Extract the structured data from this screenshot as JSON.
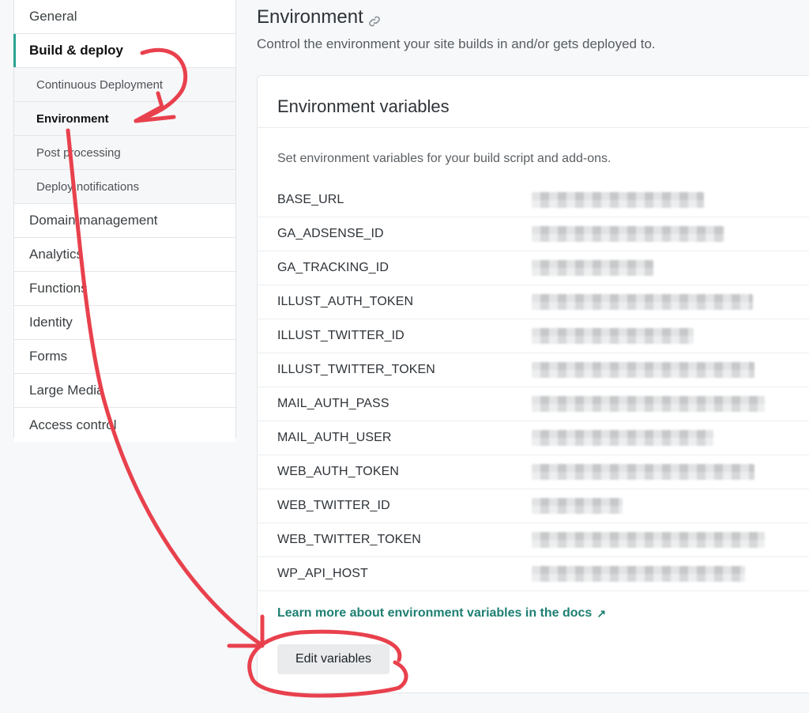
{
  "sidebar": {
    "items": [
      {
        "label": "General"
      },
      {
        "label": "Build & deploy"
      },
      {
        "label": "Domain management"
      },
      {
        "label": "Analytics"
      },
      {
        "label": "Functions"
      },
      {
        "label": "Identity"
      },
      {
        "label": "Forms"
      },
      {
        "label": "Large Media"
      },
      {
        "label": "Access control"
      }
    ],
    "subitems": [
      {
        "label": "Continuous Deployment"
      },
      {
        "label": "Environment"
      },
      {
        "label": "Post processing"
      },
      {
        "label": "Deploy notifications"
      }
    ]
  },
  "page": {
    "title": "Environment",
    "description": "Control the environment your site builds in and/or gets deployed to."
  },
  "card": {
    "title": "Environment variables",
    "description": "Set environment variables for your build script and add-ons.",
    "variables": [
      {
        "key": "BASE_URL"
      },
      {
        "key": "GA_ADSENSE_ID"
      },
      {
        "key": "GA_TRACKING_ID"
      },
      {
        "key": "ILLUST_AUTH_TOKEN"
      },
      {
        "key": "ILLUST_TWITTER_ID"
      },
      {
        "key": "ILLUST_TWITTER_TOKEN"
      },
      {
        "key": "MAIL_AUTH_PASS"
      },
      {
        "key": "MAIL_AUTH_USER"
      },
      {
        "key": "WEB_AUTH_TOKEN"
      },
      {
        "key": "WEB_TWITTER_ID"
      },
      {
        "key": "WEB_TWITTER_TOKEN"
      },
      {
        "key": "WP_API_HOST"
      }
    ],
    "docs_link": "Learn more about environment variables in the docs",
    "docs_link_icon": "arrow-up-right-icon",
    "edit_button": "Edit variables"
  },
  "colors": {
    "accent": "#2aa392",
    "link": "#1d7f72",
    "annotation": "#e8414d"
  }
}
